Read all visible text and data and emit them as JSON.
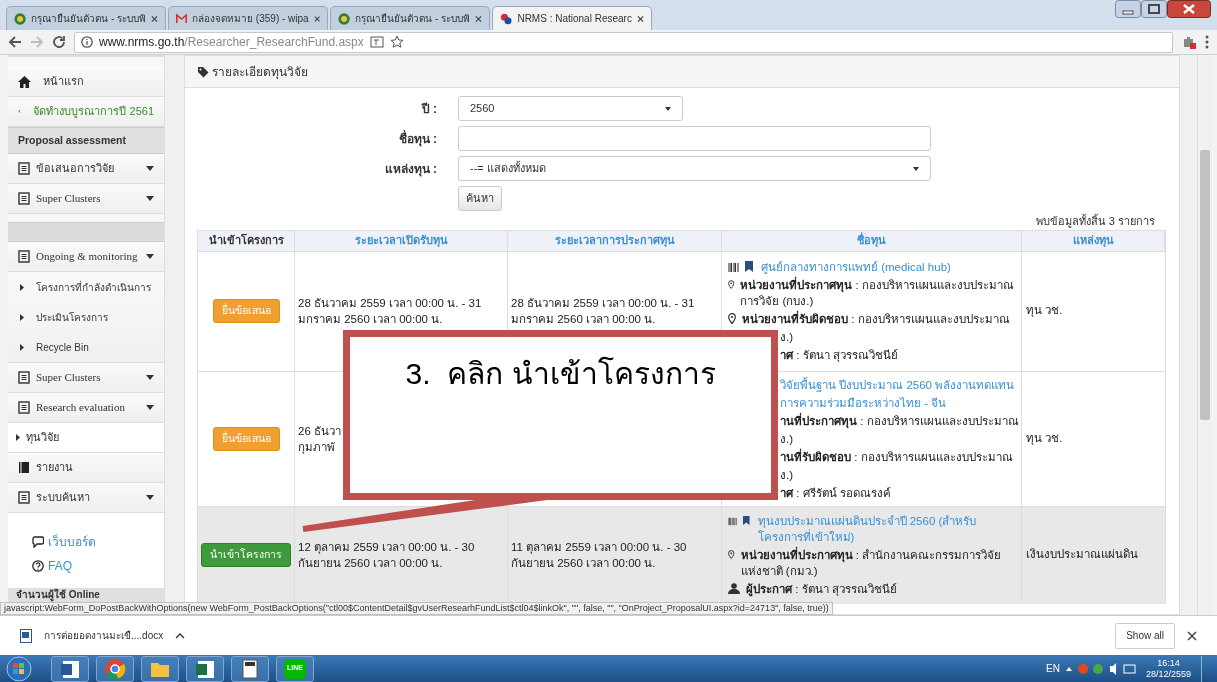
{
  "browser": {
    "tabs": [
      {
        "title": "กรุณายืนยันตัวตน - ระบบพิ",
        "kind": "seal",
        "selected": false
      },
      {
        "title": "กล่องจดหมาย (359) - wipa",
        "kind": "mail",
        "selected": false
      },
      {
        "title": "กรุณายืนยันตัวตน - ระบบพิ",
        "kind": "seal",
        "selected": false
      },
      {
        "title": "NRMS : National Researc",
        "kind": "nrms",
        "selected": true
      }
    ],
    "url_host": "www.nrms.go.th",
    "url_path": "/Researcher_ResearchFund.aspx"
  },
  "sidebar": {
    "items": [
      {
        "kind": "home",
        "label": "หน้าแรก"
      },
      {
        "kind": "budget",
        "label": "จัดทำงบบูรณาการปี 2561"
      },
      {
        "kind": "header",
        "label": "Proposal assessment"
      },
      {
        "kind": "menu",
        "label": "ข้อเสนอการวิจัย"
      },
      {
        "kind": "menu",
        "label": "Super Clusters"
      },
      {
        "kind": "spacer"
      },
      {
        "kind": "menu",
        "label": "Ongoing & monitoring",
        "children": [
          {
            "label": "โครงการที่กำลังดำเนินการ"
          },
          {
            "label": "ประเมินโครงการ"
          },
          {
            "label": "Recycle Bin"
          }
        ]
      },
      {
        "kind": "menu",
        "label": "Super Clusters"
      },
      {
        "kind": "menu",
        "label": "Research evaluation"
      },
      {
        "kind": "sub",
        "label": "ทุนวิจัย"
      },
      {
        "kind": "report",
        "label": "รายงาน"
      },
      {
        "kind": "menu",
        "label": "ระบบค้นหา"
      }
    ],
    "links": [
      {
        "kind": "board",
        "label": "เว็บบอร์ด"
      },
      {
        "kind": "faq",
        "label": "FAQ"
      }
    ],
    "online_header": "จำนวนผู้ใช้ Online"
  },
  "panel": {
    "title": "รายละเอียดทุนวิจัย",
    "form": {
      "year_label": "ปี :",
      "year_value": "2560",
      "name_label": "ชื่อทุน :",
      "source_label": "แหล่งทุน :",
      "source_value": "--= แสดงทั้งหมด",
      "search_button": "ค้นหา"
    },
    "result_count": "พบข้อมูลทั้งสิ้น 3 รายการ",
    "table": {
      "columns": [
        "นำเข้าโครงการ",
        "ระยะเวลาเปิดรับทุน",
        "ระยะเวลาการประกาศทุน",
        "ชื่อทุน",
        "แหล่งทุน"
      ],
      "rows": [
        {
          "highlighted": false,
          "action": {
            "kind": "submit",
            "label": "ยื่นข้อเสนอ"
          },
          "open_period": [
            "28 ธันวาคม 2559 เวลา 00:00 น. - 31",
            "มกราคม 2560 เวลา 00:00 น."
          ],
          "announce_period": [
            "28 ธันวาคม 2559 เวลา 00:00 น. - 31",
            "มกราคม 2560 เวลา 00:00 น."
          ],
          "name_lines": [
            {
              "kind": "title",
              "text": "ศูนย์กลางทางการแพทย์ (medical hub)"
            },
            {
              "kind": "unit",
              "text": "**หน่วยงานที่ประกาศทุน** : กองบริหารแผนและงบประมาณการวิจัย (กบง.)"
            },
            {
              "kind": "unit",
              "text": "**หน่วยงานที่รับผิดชอบ** : กองบริหารแผนและงบประมาณ"
            },
            {
              "kind": "fragment",
              "text": "ง.)"
            },
            {
              "kind": "fragment",
              "text": "**าศ** : รัตนา สุวรรณวิชนีย์"
            }
          ],
          "source": "ทุน วช."
        },
        {
          "highlighted": false,
          "action": {
            "kind": "submit",
            "label": "ยื่นข้อเสนอ"
          },
          "open_period": [
            "26 ธันวา",
            "กุมภาพั"
          ],
          "name_lines": [
            {
              "kind": "title_fragment",
              "text": "วิจัยพื้นฐาน ปีงบประมาณ 2560 พลังงานทดแทน"
            },
            {
              "kind": "title_fragment",
              "text": "การความร่วมมือระหว่างไทย - จีน"
            },
            {
              "kind": "fragment",
              "text": "**านที่ประกาศทุน** : กองบริหารแผนและงบประมาณ"
            },
            {
              "kind": "fragment",
              "text": "ง.)"
            },
            {
              "kind": "fragment",
              "text": "**านที่รับผิดชอบ** : กองบริหารแผนและงบประมาณ"
            },
            {
              "kind": "fragment",
              "text": "ง.)"
            },
            {
              "kind": "fragment",
              "text": "**าศ** : ศรีรัตน์ รอดณรงค์"
            }
          ],
          "source": "ทุน วช."
        },
        {
          "highlighted": true,
          "action": {
            "kind": "import",
            "label": "นำเข้าโครงการ"
          },
          "open_period": [
            "12 ตุลาคม 2559 เวลา 00:00 น. - 30",
            "กันยายน 2560 เวลา 00:00 น."
          ],
          "announce_period": [
            "11 ตุลาคม 2559 เวลา 00:00 น. - 30",
            "กันยายน 2560 เวลา 00:00 น."
          ],
          "name_lines": [
            {
              "kind": "title",
              "text": "ทุนงบประมาณแผ่นดินประจำปี 2560 (สำหรับโครงการที่เข้าใหม่)"
            },
            {
              "kind": "unit",
              "text": "**หน่วยงานที่ประกาศทุน** : สำนักงานคณะกรรมการวิจัยแห่งชาติ (กมว.)"
            },
            {
              "kind": "person",
              "text": "**ผู้ประกาศ** : รัตนา สุวรรณวิชนีย์"
            }
          ],
          "source": "เงินงบประมาณแผ่นดิน"
        }
      ]
    }
  },
  "callout": {
    "text": "3.  คลิก นำเข้าโครงการ"
  },
  "status_url": "javascript:WebForm_DoPostBackWithOptions(new WebForm_PostBackOptions(\"ctl00$ContentDetail$gvUserResearhFundList$ctl04$linkOk\", \"\", false, \"\", \"OnProject_ProposalUI.aspx?id=24713\", false, true))",
  "download": {
    "file": "การต่อยอดงานมะเขื....docx",
    "show_all": "Show all"
  },
  "taskbar": {
    "apps": [
      {
        "kind": "word"
      },
      {
        "kind": "chrome"
      },
      {
        "kind": "folder"
      },
      {
        "kind": "excel"
      },
      {
        "kind": "calc"
      },
      {
        "kind": "line",
        "label": "LINE"
      }
    ],
    "lang": "EN",
    "time": "16:14",
    "date": "28/12/2559"
  }
}
